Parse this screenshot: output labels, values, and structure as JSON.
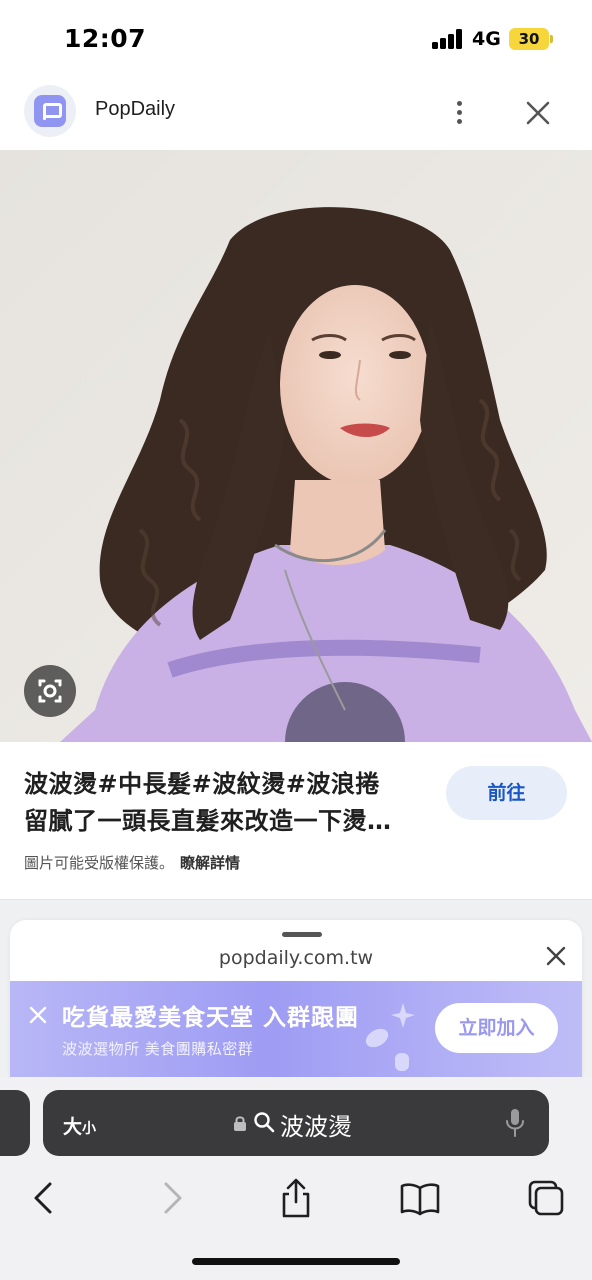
{
  "status_bar": {
    "time": "12:07",
    "network": "4G",
    "battery": "30",
    "battery_color": "#f7d63b"
  },
  "app_header": {
    "app_name": "PopDaily",
    "logo_icon": "popdaily-logo",
    "more_icon": "more-vertical-icon",
    "close_icon": "close-icon"
  },
  "image_result": {
    "photo_icon": "lens-search-icon",
    "title_lines": [
      "波波燙#中長髮#波紋燙#波浪捲",
      "留膩了一頭長直髮來改造一下燙…"
    ],
    "goto_label": "前往",
    "copyright_text": "圖片可能受版權保護。",
    "learn_more": "瞭解詳情",
    "accent": "#1a57c5"
  },
  "web_sheet": {
    "url": "popdaily.com.tw",
    "banner_title": "吃貨最愛美食天堂 入群跟團",
    "banner_subtitle": "波波選物所 美食團購私密群",
    "join_label": "立即加入",
    "banner_color": "#9e9cf3"
  },
  "browser": {
    "text_size_big": "大",
    "text_size_small": "小",
    "query": "波波燙",
    "icons": [
      "lock-icon",
      "search-icon",
      "mic-icon",
      "back-icon",
      "forward-icon",
      "share-icon",
      "bookmarks-icon",
      "tabs-icon"
    ]
  }
}
